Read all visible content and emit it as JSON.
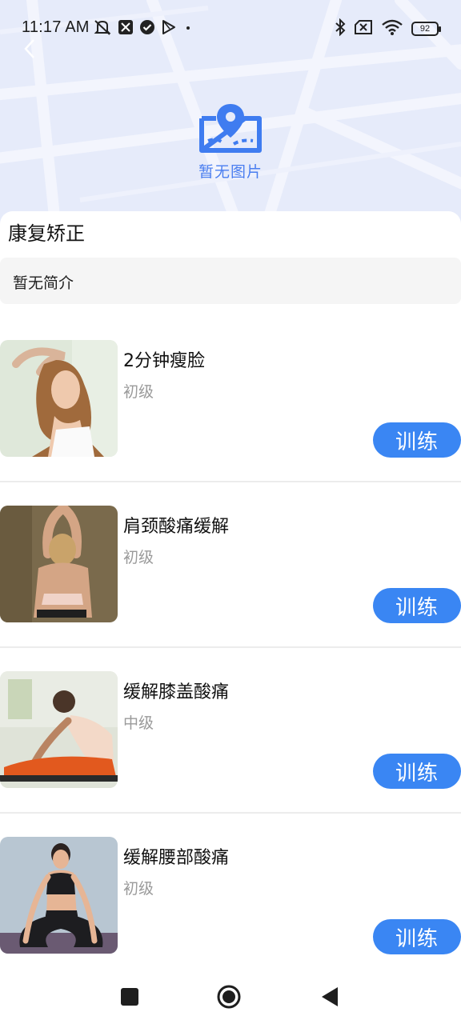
{
  "status_bar": {
    "time": "11:17 AM",
    "battery": "92"
  },
  "hero": {
    "placeholder_text": "暂无图片",
    "icon": "map-pin-icon"
  },
  "course": {
    "title": "康复矫正",
    "intro": "暂无简介"
  },
  "items": [
    {
      "name": "2分钟瘦脸",
      "level": "初级",
      "button": "训练"
    },
    {
      "name": "肩颈酸痛缓解",
      "level": "初级",
      "button": "训练"
    },
    {
      "name": "缓解膝盖酸痛",
      "level": "中级",
      "button": "训练"
    },
    {
      "name": "缓解腰部酸痛",
      "level": "初级",
      "button": "训练"
    }
  ],
  "colors": {
    "accent": "#3a86f3",
    "hero_bg": "#e6ebfa",
    "level_text": "#9a9a9a"
  },
  "nav": {
    "icons": [
      "recents-square-icon",
      "home-circle-icon",
      "back-triangle-icon"
    ]
  }
}
